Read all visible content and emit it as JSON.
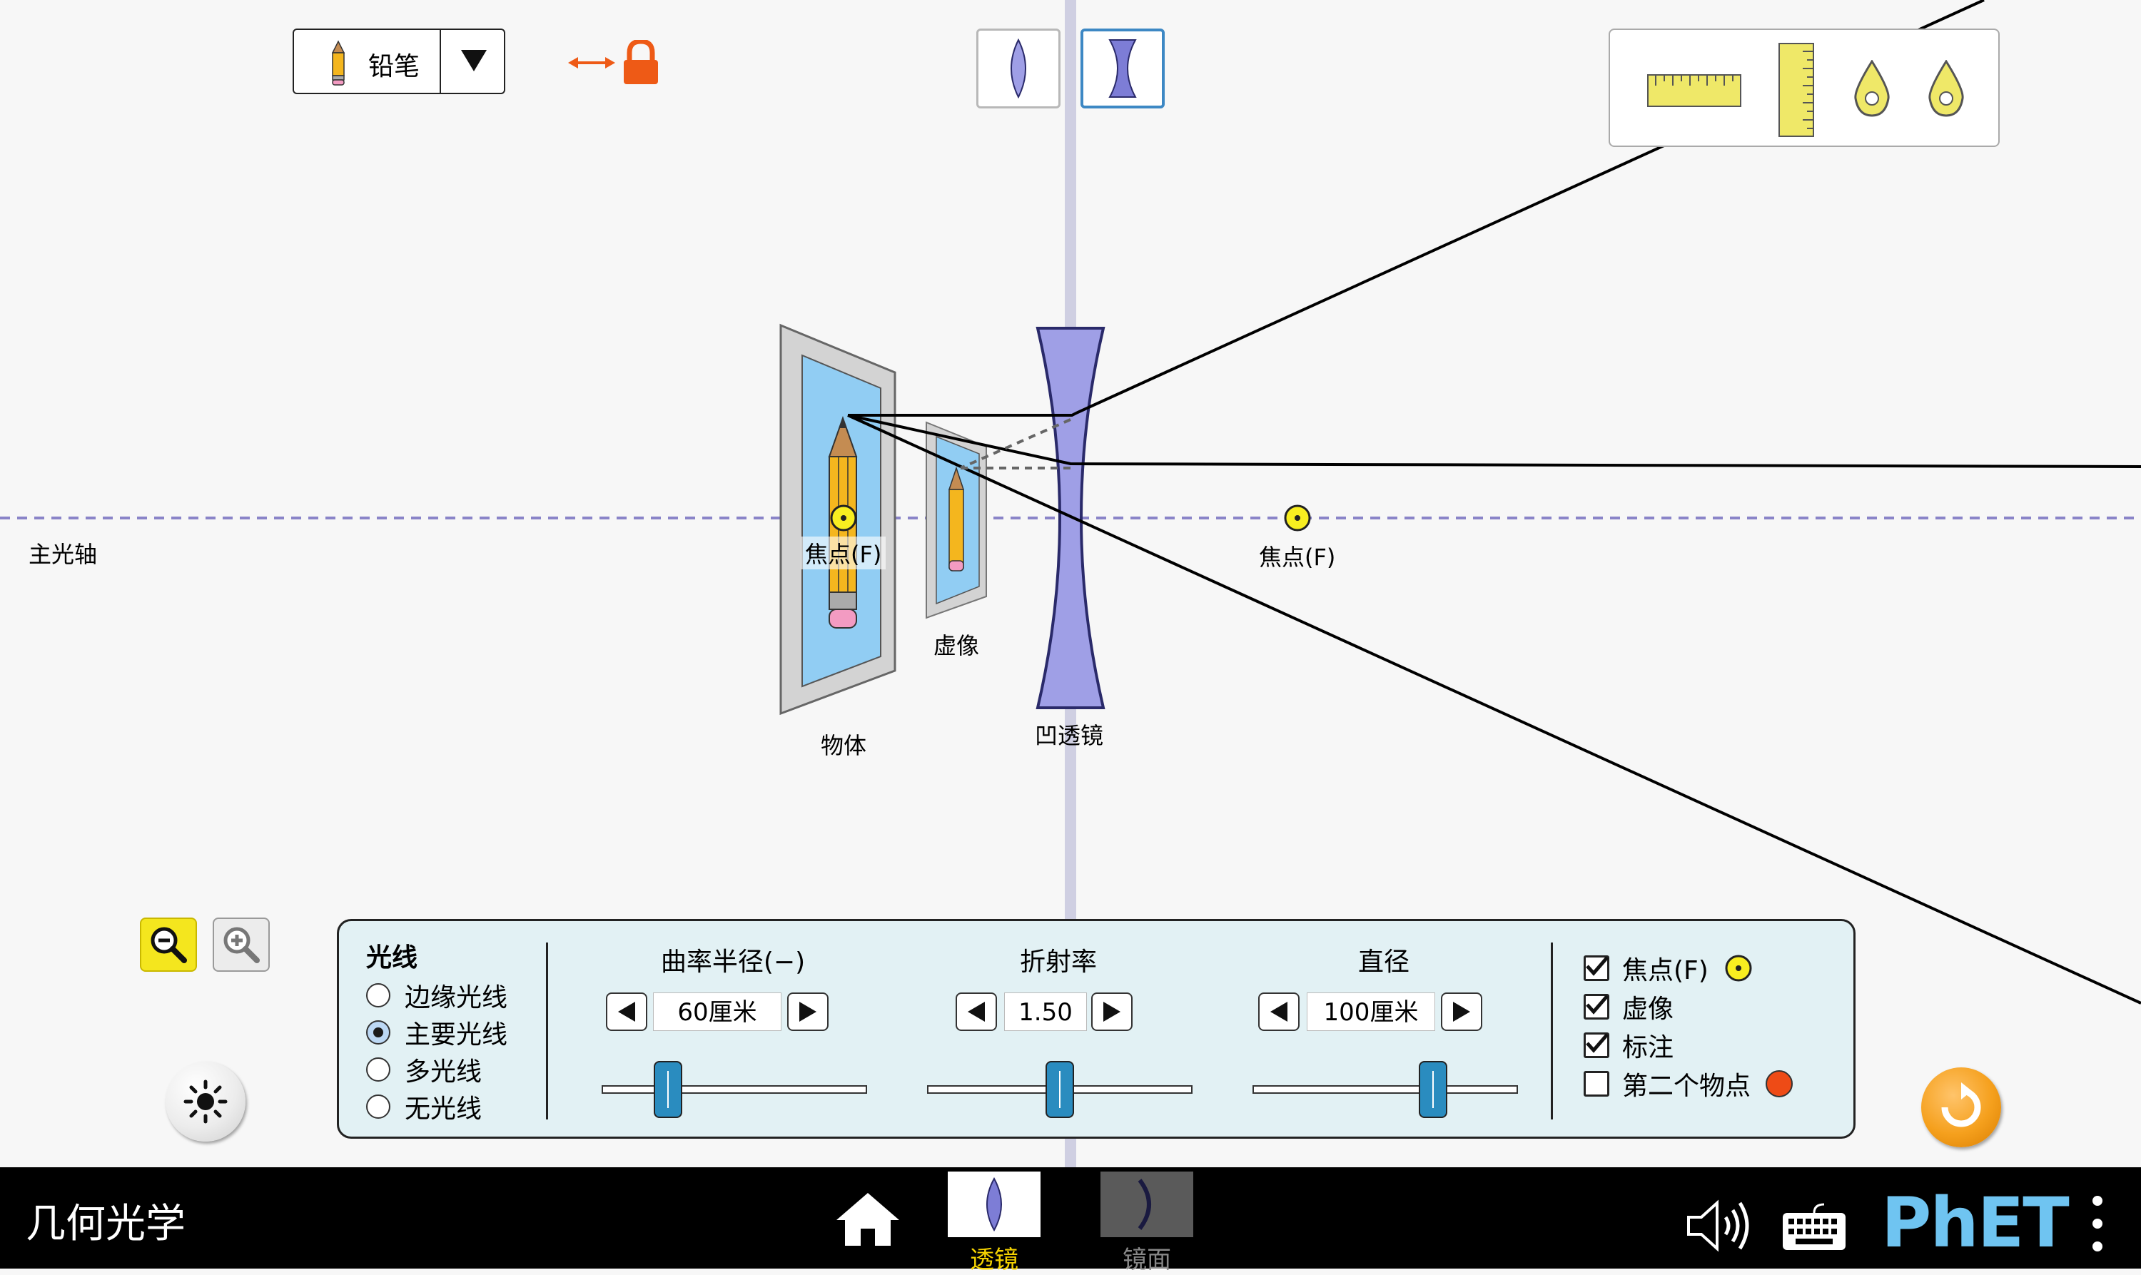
{
  "object_selector": {
    "label": "铅笔",
    "icon": "pencil-icon"
  },
  "lens_modes": [
    {
      "name": "convex-lens",
      "selected": false
    },
    {
      "name": "concave-lens",
      "selected": true
    }
  ],
  "scene": {
    "optical_axis_label": "主光轴",
    "focal_point_label": "焦点(F)",
    "object_label": "物体",
    "virtual_image_label": "虚像",
    "lens_label": "凹透镜"
  },
  "toolbox": {
    "tools": [
      "horizontal-ruler-icon",
      "vertical-ruler-icon",
      "position-marker-icon",
      "position-marker-icon"
    ]
  },
  "panel": {
    "rays_title": "光线",
    "ray_options": [
      {
        "label": "边缘光线",
        "selected": false
      },
      {
        "label": "主要光线",
        "selected": true
      },
      {
        "label": "多光线",
        "selected": false
      },
      {
        "label": "无光线",
        "selected": false
      }
    ],
    "controls": [
      {
        "title": "曲率半径(−)",
        "value": "60厘米",
        "slider_fraction": 0.25
      },
      {
        "title": "折射率",
        "value": "1.50",
        "slider_fraction": 0.5
      },
      {
        "title": "直径",
        "value": "100厘米",
        "slider_fraction": 0.68
      }
    ],
    "checkboxes": [
      {
        "label": "焦点(F)",
        "checked": true
      },
      {
        "label": "虚像",
        "checked": true
      },
      {
        "label": "标注",
        "checked": true
      },
      {
        "label": "第二个物点",
        "checked": false
      }
    ]
  },
  "navbar": {
    "title": "几何光学",
    "screens": [
      {
        "label": "透镜",
        "selected": true
      },
      {
        "label": "镜面",
        "selected": false
      }
    ],
    "brand": "PhET"
  },
  "colors": {
    "lens_fill": "#9f9fe6",
    "focal_point": "#f8ee20",
    "axis": "#8a84c8",
    "reset": "#f5a01d",
    "selected_mode_border": "#3d88c4",
    "second_point": "#ee4b16"
  }
}
